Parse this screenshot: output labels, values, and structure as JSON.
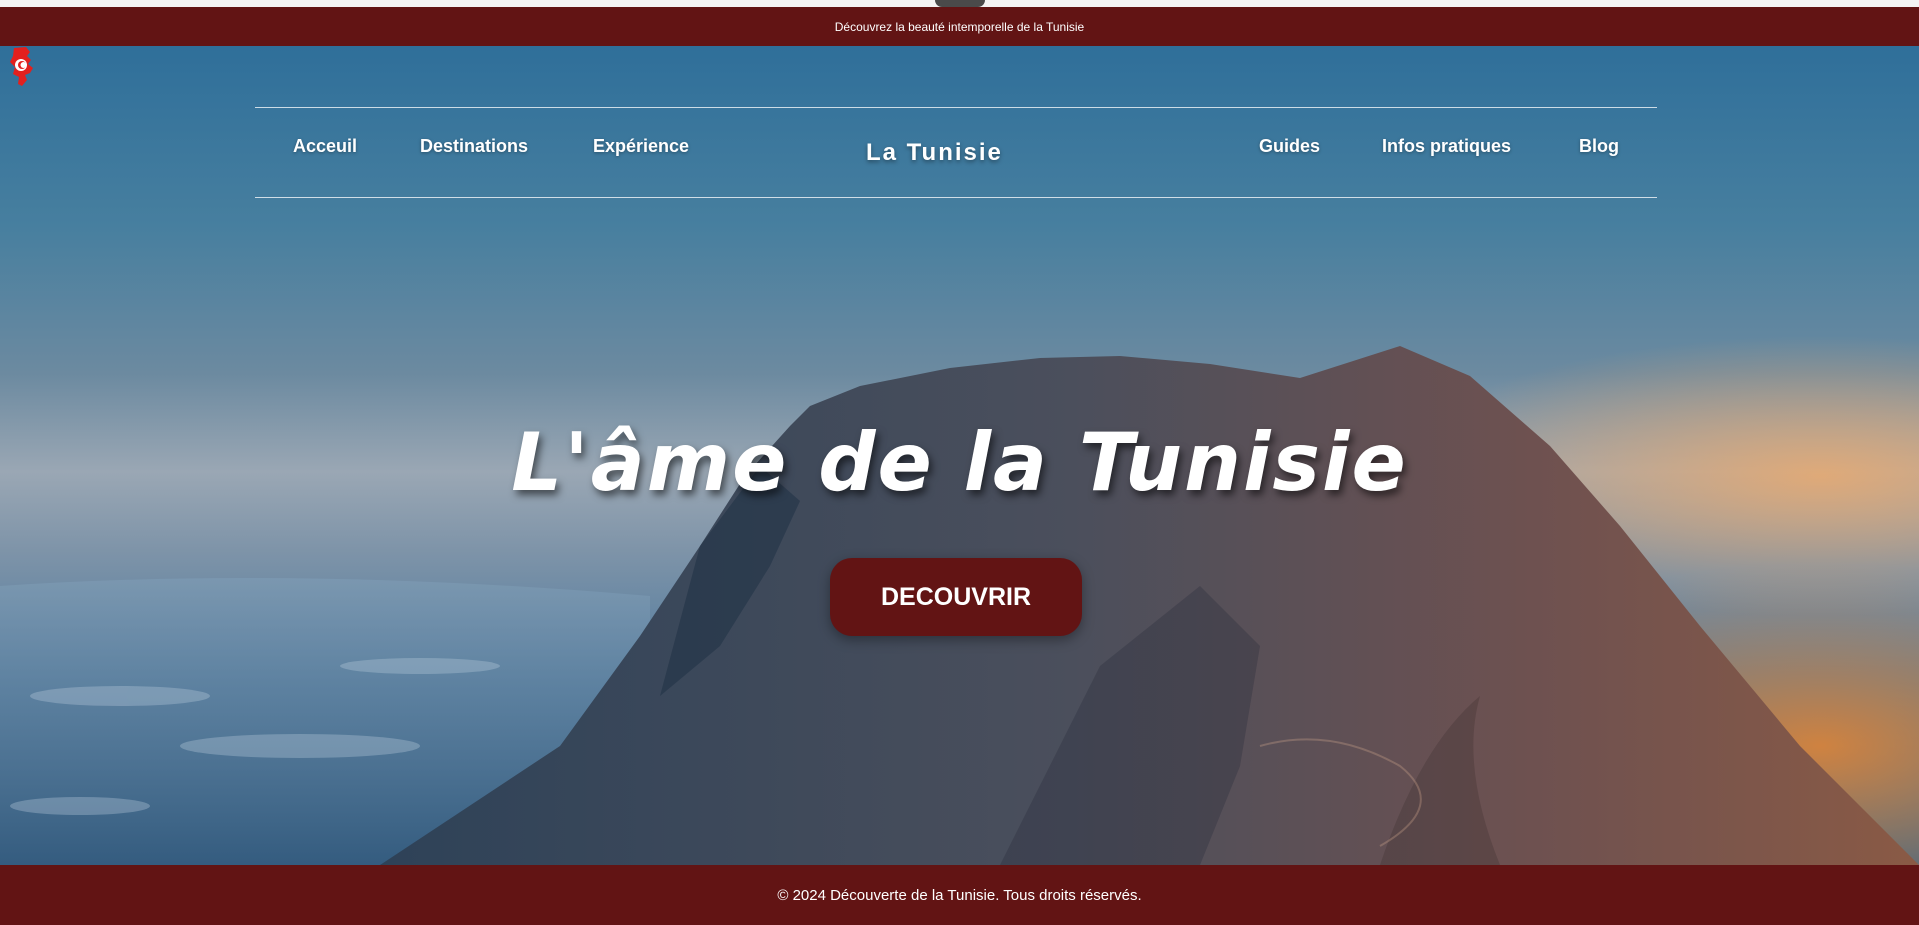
{
  "announcement": {
    "text": "Découvrez la beauté intemporelle de la Tunisie"
  },
  "nav": {
    "left_links": [
      {
        "label": "Acceuil"
      },
      {
        "label": "Destinations"
      },
      {
        "label": "Expérience"
      }
    ],
    "logo": {
      "text": "La Tunisie",
      "icon": "tunisia-map-flag-icon"
    },
    "right_links": [
      {
        "label": "Guides"
      },
      {
        "label": "Infos pratiques"
      },
      {
        "label": "Blog"
      }
    ]
  },
  "hero": {
    "title": "L'âme de la Tunisie",
    "cta_label": "DECOUVRIR",
    "background": "mountain-landscape-image"
  },
  "footer": {
    "text": "© 2024 Découverte de la Tunisie. Tous droits réservés."
  },
  "colors": {
    "brand": "#621414",
    "text": "#ffffff"
  }
}
